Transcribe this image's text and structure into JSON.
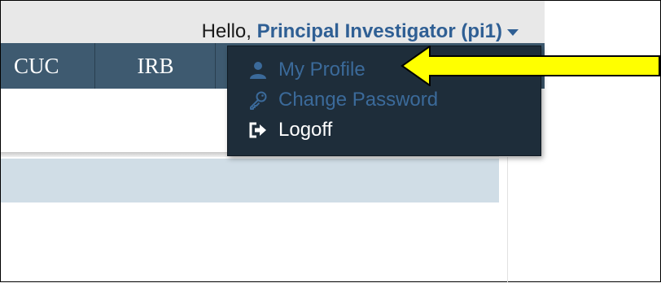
{
  "header": {
    "greeting_prefix": "Hello,",
    "user_name": "Principal Investigator (pi1)"
  },
  "nav": {
    "tabs": [
      {
        "label": "CUC"
      },
      {
        "label": "IRB"
      }
    ]
  },
  "user_menu": {
    "items": [
      {
        "label": "My Profile",
        "icon": "user-icon"
      },
      {
        "label": "Change Password",
        "icon": "key-icon"
      },
      {
        "label": "Logoff",
        "icon": "logout-icon"
      }
    ]
  },
  "colors": {
    "accent": "#2f5f94",
    "navbar": "#3e5a70",
    "menu_bg": "#1e2d3a",
    "annotation_arrow": "#ffff00"
  }
}
